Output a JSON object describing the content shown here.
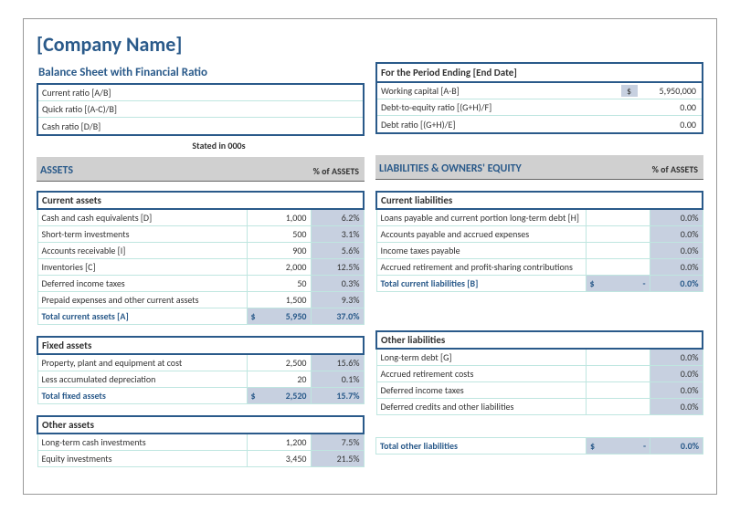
{
  "company": "[Company Name]",
  "subtitle": "Balance Sheet with Financial Ratio",
  "period_label": "For the Period Ending [End Date]",
  "ratios_left": [
    {
      "label": "Current ratio  [A/B]",
      "value": ""
    },
    {
      "label": "Quick ratio  [(A-C)/B]",
      "value": ""
    },
    {
      "label": "Cash ratio  [D/B]",
      "value": ""
    }
  ],
  "ratios_right": [
    {
      "label": "Working capital  [A-B]",
      "cur": "$",
      "value": "5,950,000"
    },
    {
      "label": "Debt-to-equity ratio  [(G+H)/F]",
      "cur": "",
      "value": "0.00"
    },
    {
      "label": "Debt ratio  [(G+H)/E]",
      "cur": "",
      "value": "0.00"
    }
  ],
  "stated": "Stated in 000s",
  "headers": {
    "assets": "ASSETS",
    "pct_assets": "% of ASSETS",
    "liab": "LIABILITIES & OWNERS' EQUITY",
    "pct_assets2": "% of ASSETS"
  },
  "left_groups": [
    {
      "head": "Current assets",
      "rows": [
        {
          "label": "Cash and cash equivalents  [D]",
          "val": "1,000",
          "pct": "6.2%"
        },
        {
          "label": "Short-term investments",
          "val": "500",
          "pct": "3.1%"
        },
        {
          "label": "Accounts receivable  [I]",
          "val": "900",
          "pct": "5.6%"
        },
        {
          "label": "Inventories  [C]",
          "val": "2,000",
          "pct": "12.5%"
        },
        {
          "label": "Deferred income taxes",
          "val": "50",
          "pct": "0.3%"
        },
        {
          "label": "Prepaid expenses and other current assets",
          "val": "1,500",
          "pct": "9.3%"
        }
      ],
      "total": {
        "label": "Total current assets  [A]",
        "cur": "$",
        "val": "5,950",
        "pct": "37.0%"
      }
    },
    {
      "head": "Fixed assets",
      "rows": [
        {
          "label": "Property, plant and equipment at cost",
          "val": "2,500",
          "pct": "15.6%"
        },
        {
          "label": "Less accumulated depreciation",
          "val": "20",
          "pct": "0.1%"
        }
      ],
      "total": {
        "label": "Total fixed assets",
        "cur": "$",
        "val": "2,520",
        "pct": "15.7%"
      }
    },
    {
      "head": "Other assets",
      "rows": [
        {
          "label": "Long-term cash investments",
          "val": "1,200",
          "pct": "7.5%"
        },
        {
          "label": "Equity investments",
          "val": "3,450",
          "pct": "21.5%"
        }
      ],
      "total": null
    }
  ],
  "right_groups": [
    {
      "head": "Current liabilities",
      "rows": [
        {
          "label": "Loans payable and current portion long-term debt  [H]",
          "val": "",
          "pct": "0.0%"
        },
        {
          "label": "Accounts payable and accrued expenses",
          "val": "",
          "pct": "0.0%"
        },
        {
          "label": "Income taxes payable",
          "val": "",
          "pct": "0.0%"
        },
        {
          "label": "Accrued retirement and profit-sharing contributions",
          "val": "",
          "pct": "0.0%"
        }
      ],
      "total": {
        "label": "Total current liabilities  [B]",
        "cur": "$",
        "val": "-",
        "pct": "0.0%"
      }
    },
    {
      "head": "Other liabilities",
      "rows": [
        {
          "label": "Long-term debt  [G]",
          "val": "",
          "pct": "0.0%"
        },
        {
          "label": "Accrued retirement costs",
          "val": "",
          "pct": "0.0%"
        },
        {
          "label": "Deferred income taxes",
          "val": "",
          "pct": "0.0%"
        },
        {
          "label": "Deferred credits and other liabilities",
          "val": "",
          "pct": "0.0%"
        }
      ],
      "total": {
        "label": "Total other liabilities",
        "cur": "$",
        "val": "-",
        "pct": "0.0%"
      }
    }
  ]
}
